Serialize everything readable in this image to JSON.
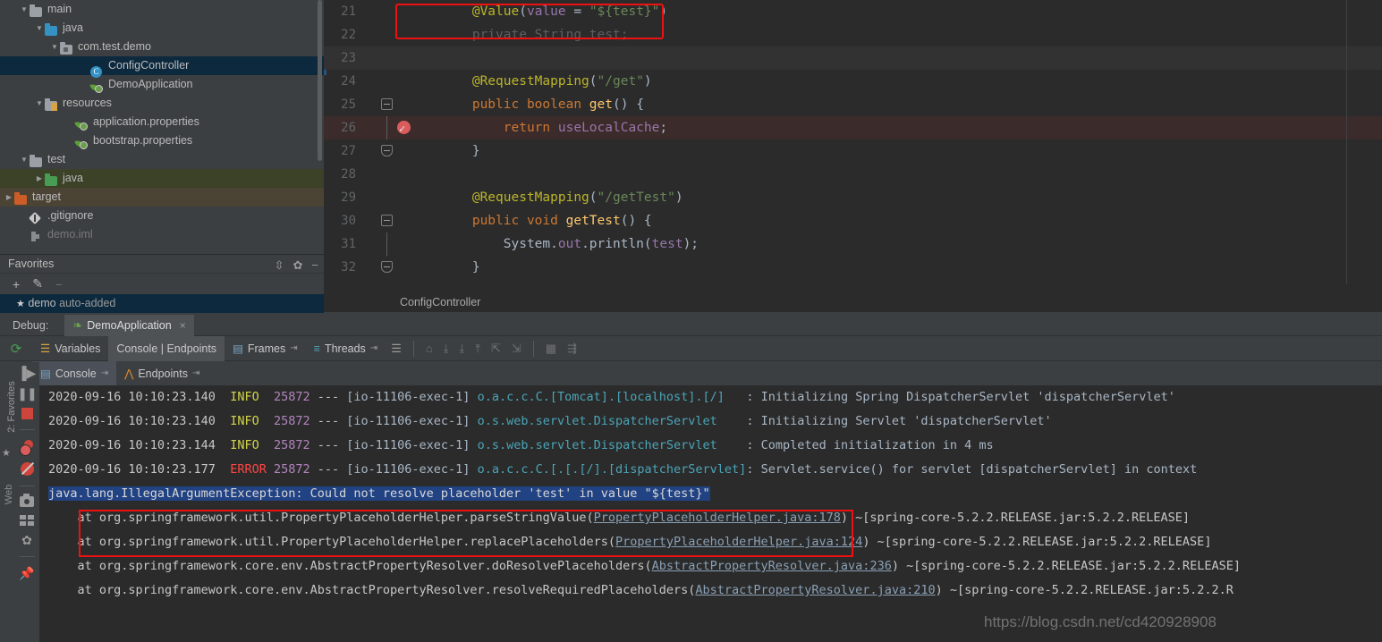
{
  "project_tree": {
    "rows": [
      {
        "label": "main",
        "indent": 3,
        "arrow": "down",
        "icon": "folder-grey",
        "state": "normal"
      },
      {
        "label": "java",
        "indent": 4,
        "arrow": "down",
        "icon": "folder-blue",
        "state": "normal"
      },
      {
        "label": "com.test.demo",
        "indent": 5,
        "arrow": "down",
        "icon": "folder-package",
        "state": "normal"
      },
      {
        "label": "ConfigController",
        "indent": 7,
        "arrow": "none",
        "icon": "class-icon",
        "state": "selected"
      },
      {
        "label": "DemoApplication",
        "indent": 7,
        "arrow": "none",
        "icon": "spring-bean-icon",
        "state": "normal"
      },
      {
        "label": "resources",
        "indent": 4,
        "arrow": "down",
        "icon": "folder-resources",
        "state": "normal"
      },
      {
        "label": "application.properties",
        "indent": 6,
        "arrow": "none",
        "icon": "spring-leaf-icon",
        "state": "normal"
      },
      {
        "label": "bootstrap.properties",
        "indent": 6,
        "arrow": "none",
        "icon": "spring-leaf-icon",
        "state": "normal"
      },
      {
        "label": "test",
        "indent": 3,
        "arrow": "down",
        "icon": "folder-grey",
        "state": "normal"
      },
      {
        "label": "java",
        "indent": 4,
        "arrow": "right",
        "icon": "folder-green",
        "state": "green"
      },
      {
        "label": "target",
        "indent": 2,
        "arrow": "right",
        "icon": "folder-orange",
        "state": "brown"
      },
      {
        "label": ".gitignore",
        "indent": 3,
        "arrow": "none",
        "icon": "gitignore-icon",
        "state": "normal"
      },
      {
        "label": "demo.iml",
        "indent": 3,
        "arrow": "none",
        "icon": "iml-icon",
        "state": "dim"
      }
    ]
  },
  "favorites": {
    "title": "Favorites",
    "header_icons": [
      "collapse-all-icon",
      "gear-icon",
      "hide-icon"
    ],
    "toolbar_icons": [
      "add-icon",
      "edit-icon",
      "remove-icon"
    ],
    "item_label": "demo",
    "item_suffix": "auto-added"
  },
  "editor": {
    "breadcrumb": "ConfigController",
    "lines": [
      {
        "num": "21",
        "tokens": [
          {
            "t": "        ",
            "c": "pln"
          },
          {
            "t": "@Value",
            "c": "anno"
          },
          {
            "t": "(",
            "c": "pln"
          },
          {
            "t": "value",
            "c": "var"
          },
          {
            "t": " = ",
            "c": "pln"
          },
          {
            "t": "\"${test}\"",
            "c": "str"
          },
          {
            "t": ")",
            "c": "pln"
          }
        ],
        "bg": "none",
        "fold": "none",
        "breakpoint": false
      },
      {
        "num": "22",
        "tokens": [
          {
            "t": "        private String test;",
            "c": "dimtxt"
          }
        ],
        "bg": "none",
        "fold": "none",
        "breakpoint": false
      },
      {
        "num": "23",
        "tokens": [
          {
            "t": "",
            "c": "pln"
          }
        ],
        "bg": "grey",
        "fold": "none",
        "breakpoint": false
      },
      {
        "num": "24",
        "tokens": [
          {
            "t": "        ",
            "c": "pln"
          },
          {
            "t": "@RequestMapping",
            "c": "anno"
          },
          {
            "t": "(",
            "c": "pln"
          },
          {
            "t": "\"/get\"",
            "c": "str"
          },
          {
            "t": ")",
            "c": "pln"
          }
        ],
        "bg": "none",
        "fold": "none",
        "breakpoint": false
      },
      {
        "num": "25",
        "tokens": [
          {
            "t": "        ",
            "c": "pln"
          },
          {
            "t": "public boolean ",
            "c": "kw"
          },
          {
            "t": "get",
            "c": "fn"
          },
          {
            "t": "() {",
            "c": "pln"
          }
        ],
        "bg": "none",
        "fold": "top",
        "breakpoint": false
      },
      {
        "num": "26",
        "tokens": [
          {
            "t": "            ",
            "c": "pln"
          },
          {
            "t": "return ",
            "c": "kw"
          },
          {
            "t": "useLocalCache",
            "c": "var"
          },
          {
            "t": ";",
            "c": "pln"
          }
        ],
        "bg": "red",
        "fold": "line",
        "breakpoint": true
      },
      {
        "num": "27",
        "tokens": [
          {
            "t": "        }",
            "c": "pln"
          }
        ],
        "bg": "none",
        "fold": "bot",
        "breakpoint": false
      },
      {
        "num": "28",
        "tokens": [
          {
            "t": "",
            "c": "pln"
          }
        ],
        "bg": "none",
        "fold": "none",
        "breakpoint": false
      },
      {
        "num": "29",
        "tokens": [
          {
            "t": "        ",
            "c": "pln"
          },
          {
            "t": "@RequestMapping",
            "c": "anno"
          },
          {
            "t": "(",
            "c": "pln"
          },
          {
            "t": "\"/getTest\"",
            "c": "str"
          },
          {
            "t": ")",
            "c": "pln"
          }
        ],
        "bg": "none",
        "fold": "none",
        "breakpoint": false
      },
      {
        "num": "30",
        "tokens": [
          {
            "t": "        ",
            "c": "pln"
          },
          {
            "t": "public void ",
            "c": "kw"
          },
          {
            "t": "getTest",
            "c": "fn"
          },
          {
            "t": "() {",
            "c": "pln"
          }
        ],
        "bg": "none",
        "fold": "top",
        "breakpoint": false
      },
      {
        "num": "31",
        "tokens": [
          {
            "t": "            System.",
            "c": "pln"
          },
          {
            "t": "out",
            "c": "var"
          },
          {
            "t": ".println(",
            "c": "pln"
          },
          {
            "t": "test",
            "c": "var"
          },
          {
            "t": ");",
            "c": "pln"
          }
        ],
        "bg": "none",
        "fold": "line",
        "breakpoint": false
      },
      {
        "num": "32",
        "tokens": [
          {
            "t": "        }",
            "c": "pln"
          }
        ],
        "bg": "none",
        "fold": "bot",
        "breakpoint": false
      }
    ]
  },
  "debug": {
    "label": "Debug:",
    "run_config": "DemoApplication",
    "close_glyph": "×",
    "rerun_icon": "rerun-icon",
    "tabs": [
      {
        "label": "Variables",
        "icon": "variables-icon",
        "active": false
      },
      {
        "label": "Console | Endpoints",
        "icon": "none",
        "active": true
      },
      {
        "label": "Frames",
        "icon": "frames-icon",
        "active": false
      },
      {
        "label": "Threads",
        "icon": "threads-icon",
        "active": false
      }
    ],
    "toolbar_icons": [
      "list-icon",
      "step-out-icon",
      "step-over-icon",
      "step-into-icon",
      "force-step-into-icon",
      "run-to-cursor-icon",
      "drop-frame-icon",
      "evaluate-icon",
      "settings-icon"
    ],
    "subtabs": [
      {
        "label": "Console",
        "icon": "console-icon",
        "active": true
      },
      {
        "label": "Endpoints",
        "icon": "endpoints-icon",
        "active": false
      }
    ],
    "rail_icons": [
      "resume-icon",
      "pause-icon",
      "stop-icon",
      "view-breakpoints-icon",
      "mute-breakpoints-icon",
      "screenshot-icon",
      "layout-icon",
      "settings-icon",
      "pin-icon"
    ],
    "console_gutter_icons": [
      "up-icon",
      "down-icon",
      "soft-wrap-icon",
      "scroll-to-end-icon"
    ],
    "left_rail_label": "2: Favorites",
    "left_rail_label2": "Web"
  },
  "console": {
    "log_lines": [
      {
        "date": "2020-09-16 10:10:23.140",
        "level": "INFO",
        "pid": "25872",
        "dashes": "---",
        "thread": "[io-11106-exec-1]",
        "logger": "o.a.c.c.C.[Tomcat].[localhost].[/]",
        "message": ": Initializing Spring DispatcherServlet 'dispatcherServlet'"
      },
      {
        "date": "2020-09-16 10:10:23.140",
        "level": "INFO",
        "pid": "25872",
        "dashes": "---",
        "thread": "[io-11106-exec-1]",
        "logger": "o.s.web.servlet.DispatcherServlet",
        "message": ": Initializing Servlet 'dispatcherServlet'"
      },
      {
        "date": "2020-09-16 10:10:23.144",
        "level": "INFO",
        "pid": "25872",
        "dashes": "---",
        "thread": "[io-11106-exec-1]",
        "logger": "o.s.web.servlet.DispatcherServlet",
        "message": ": Completed initialization in 4 ms"
      },
      {
        "date": "2020-09-16 10:10:23.177",
        "level": "ERROR",
        "pid": "25872",
        "dashes": "---",
        "thread": "[io-11106-exec-1]",
        "logger": "o.a.c.c.C.[.[.[/].[dispatcherServlet]",
        "message": ": Servlet.service() for servlet [dispatcherServlet] in context"
      }
    ],
    "exception_line": "java.lang.IllegalArgumentException: Could not resolve placeholder 'test' in value \"${test}\"",
    "stack_lines": [
      {
        "prefix": "    at org.springframework.util.PropertyPlaceholderHelper.parseStringValue(",
        "link": "PropertyPlaceholderHelper.java:178",
        "suffix": ") ~[spring-core-5.2.2.RELEASE.jar:5.2.2.RELEASE]"
      },
      {
        "prefix": "    at org.springframework.util.PropertyPlaceholderHelper.replacePlaceholders(",
        "link": "PropertyPlaceholderHelper.java:124",
        "suffix": ") ~[spring-core-5.2.2.RELEASE.jar:5.2.2.RELEASE]"
      },
      {
        "prefix": "    at org.springframework.core.env.AbstractPropertyResolver.doResolvePlaceholders(",
        "link": "AbstractPropertyResolver.java:236",
        "suffix": ") ~[spring-core-5.2.2.RELEASE.jar:5.2.2.RELEASE]"
      },
      {
        "prefix": "    at org.springframework.core.env.AbstractPropertyResolver.resolveRequiredPlaceholders(",
        "link": "AbstractPropertyResolver.java:210",
        "suffix": ") ~[spring-core-5.2.2.RELEASE.jar:5.2.2.R"
      }
    ]
  },
  "watermark": "https://blog.csdn.net/cd420928908",
  "colors": {
    "accent_selection": "#0d293e",
    "error_red": "#ff4545",
    "info_yellow": "#d4d44a",
    "annotation_box": "#ee1111",
    "string_green": "#6a8759",
    "logger_cyan": "#4aa5b8"
  }
}
